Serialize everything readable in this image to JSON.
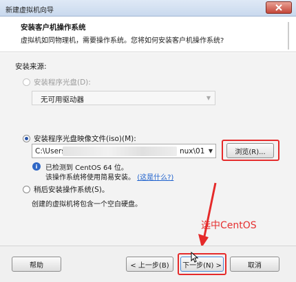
{
  "window": {
    "title": "新建虚拟机向导"
  },
  "header": {
    "title": "安装客户机操作系统",
    "description": "虚拟机如同物理机，需要操作系统。您将如何安装客户机操作系统?"
  },
  "install_source": {
    "label": "安装来源:",
    "disc_option": {
      "label": "安装程序光盘(D):",
      "selected": false,
      "enabled": false
    },
    "disc_select": {
      "value": "无可用驱动器"
    },
    "iso_option": {
      "label": "安装程序光盘映像文件(iso)(M):",
      "selected": true
    },
    "iso_path": {
      "prefix": "C:\\Users",
      "suffix": "nux\\01"
    },
    "browse_label": "浏览(R)...",
    "detect_line1": "已检测到 CentOS 64 位。",
    "detect_line2": "该操作系统将使用简易安装。",
    "detect_link": "(这是什么?)",
    "later_option": {
      "label": "稍后安装操作系统(S)。",
      "selected": false
    },
    "later_desc": "创建的虚拟机将包含一个空白硬盘。"
  },
  "annotation": {
    "text": "选中CentOS",
    "color": "#e53030"
  },
  "footer": {
    "help": "帮助",
    "back": "< 上一步(B)",
    "next": "下一步(N) >",
    "cancel": "取消"
  }
}
